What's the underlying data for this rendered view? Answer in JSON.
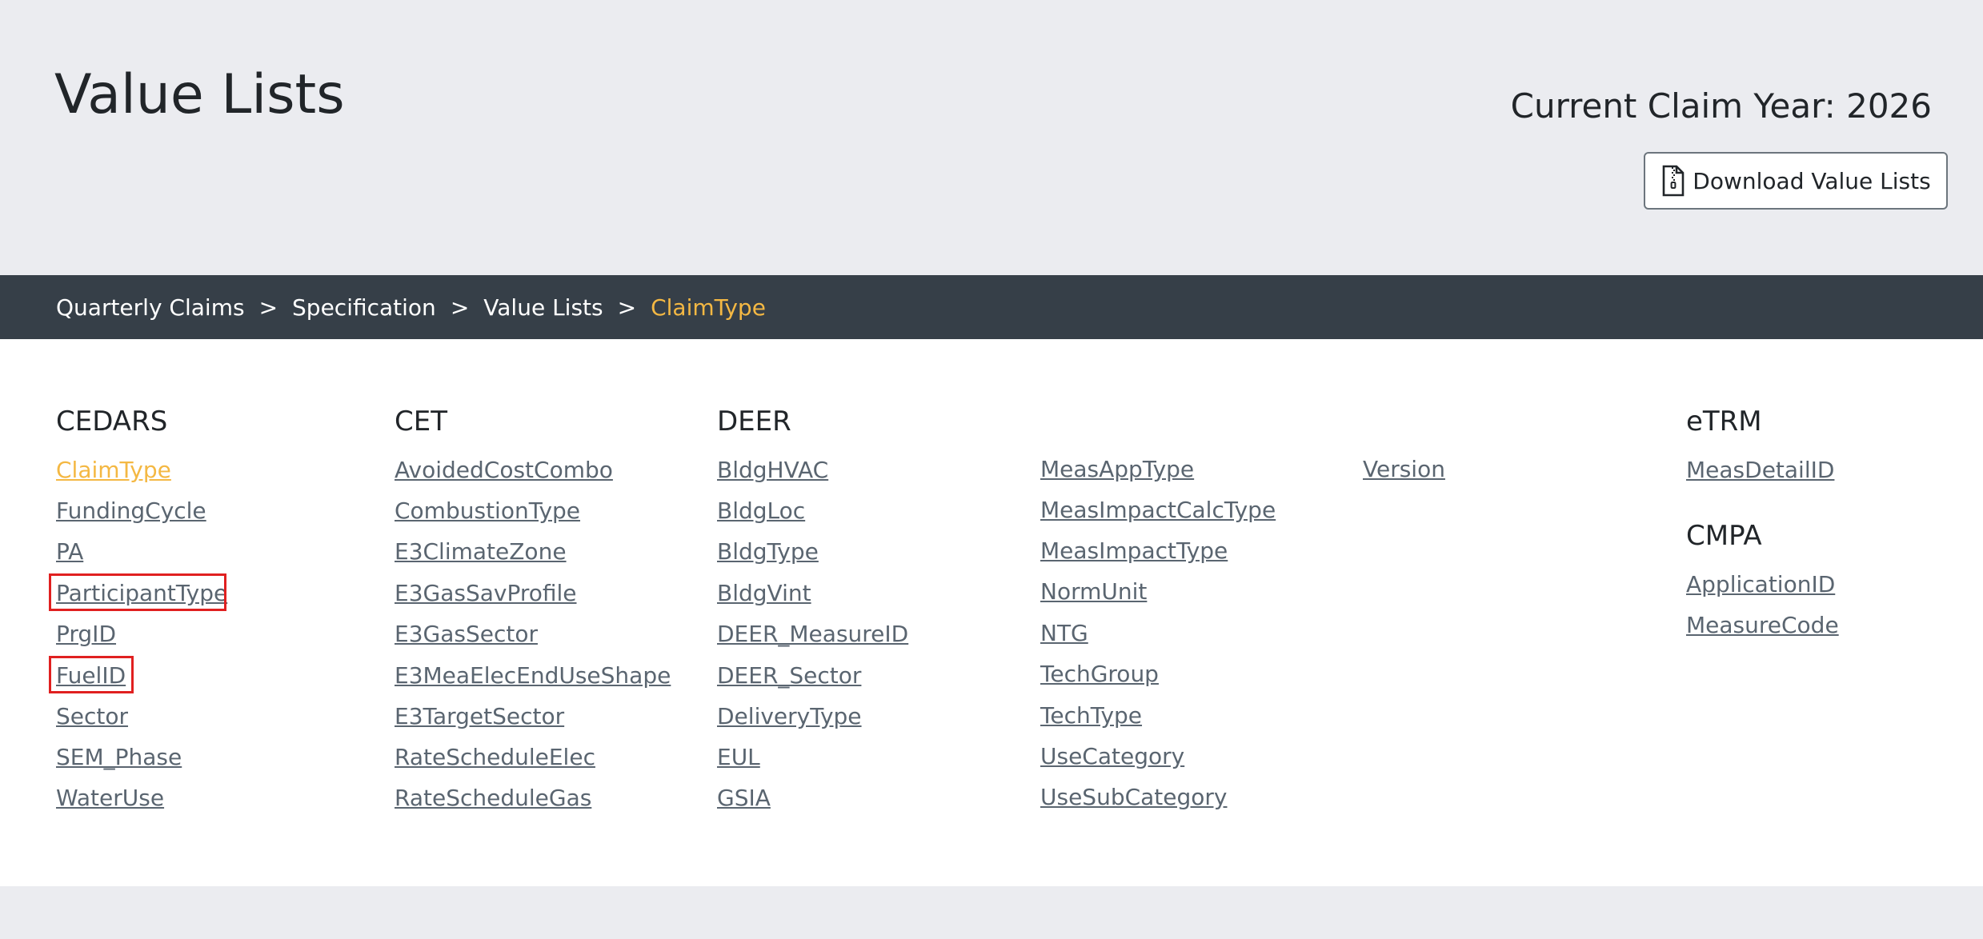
{
  "page": {
    "title": "Value Lists",
    "claim_year": "Current Claim Year: 2026",
    "download_label": "Download Value Lists"
  },
  "breadcrumb": {
    "items": [
      "Quarterly Claims",
      "Specification",
      "Value Lists"
    ],
    "separator": ">",
    "current": "ClaimType"
  },
  "sections": {
    "cedars": {
      "heading": "CEDARS",
      "links": [
        "ClaimType",
        "FundingCycle",
        "PA",
        "ParticipantType",
        "PrgID",
        "FuelID",
        "Sector",
        "SEM_Phase",
        "WaterUse"
      ]
    },
    "cet": {
      "heading": "CET",
      "links": [
        "AvoidedCostCombo",
        "CombustionType",
        "E3ClimateZone",
        "E3GasSavProfile",
        "E3GasSector",
        "E3MeaElecEndUseShape",
        "E3TargetSector",
        "RateScheduleElec",
        "RateScheduleGas"
      ]
    },
    "deer": {
      "heading": "DEER",
      "links_col1": [
        "BldgHVAC",
        "BldgLoc",
        "BldgType",
        "BldgVint",
        "DEER_MeasureID",
        "DEER_Sector",
        "DeliveryType",
        "EUL",
        "GSIA"
      ],
      "links_col2": [
        "MeasAppType",
        "MeasImpactCalcType",
        "MeasImpactType",
        "NormUnit",
        "NTG",
        "TechGroup",
        "TechType",
        "UseCategory",
        "UseSubCategory"
      ],
      "links_col3": [
        "Version"
      ]
    },
    "etrm": {
      "heading": "eTRM",
      "links": [
        "MeasDetailID"
      ]
    },
    "cmpa": {
      "heading": "CMPA",
      "links": [
        "ApplicationID",
        "MeasureCode"
      ]
    }
  },
  "colors": {
    "accent": "#f4b843",
    "breadcrumb_bg": "#363f48",
    "link": "#5a6570",
    "highlight_box": "#e02020"
  },
  "icons": {
    "download": "file-zip-icon"
  }
}
